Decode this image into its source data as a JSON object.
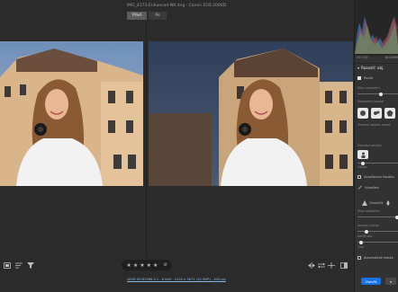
{
  "window": {
    "title": "IMG_4173-Enhanced-NR.dng  -  Canon EOS 2000D"
  },
  "view_toggle": {
    "before_label": "Před",
    "after_label": "Po"
  },
  "toolbar": {
    "left_icons": [
      "filmstrip-icon",
      "sort-icon",
      "filter-icon"
    ],
    "rating": {
      "stars": [
        "★",
        "★",
        "★",
        "★",
        "★"
      ],
      "reject": "⊘"
    },
    "right_icons": [
      "compare-icon",
      "swap-icon",
      "copy-settings-icon",
      "split-view-icon"
    ]
  },
  "file_info": "sRGB IEC61966-2.1 - 8 bitů - 3120 x 3671 (10,9MP) - 300 ppi",
  "sidebar": {
    "histogram_meta": {
      "iso": "ISO 200",
      "lens": "18-55MM",
      "aperture": "ƒ/5,6",
      "shutter": "1/200s"
    },
    "panel_title": "Rozostř. obj.",
    "apply_label": "Použít",
    "blur_amount_label": "Míra rozostření",
    "bokeh_label": "Rozostření pozadí",
    "focus_label": "Zvolená oblasti zaostř.",
    "focus_range_label": "Hloubka ostrosti",
    "subject_label": "Oblast",
    "visualize_label": "Vizualizovat hloubku",
    "refine_label": "Vylepšení",
    "boost_label": "Ohraničit",
    "boost_amount_label": "Míra rozostření",
    "highlight_boost_label": "Jasnost zvýraz.",
    "cat_eye_label": "Kočičí oko",
    "cat_eye_value": "Tvar",
    "auto_label": "Automatické maska",
    "open_button": "Otevřít",
    "more_button": "▾"
  }
}
